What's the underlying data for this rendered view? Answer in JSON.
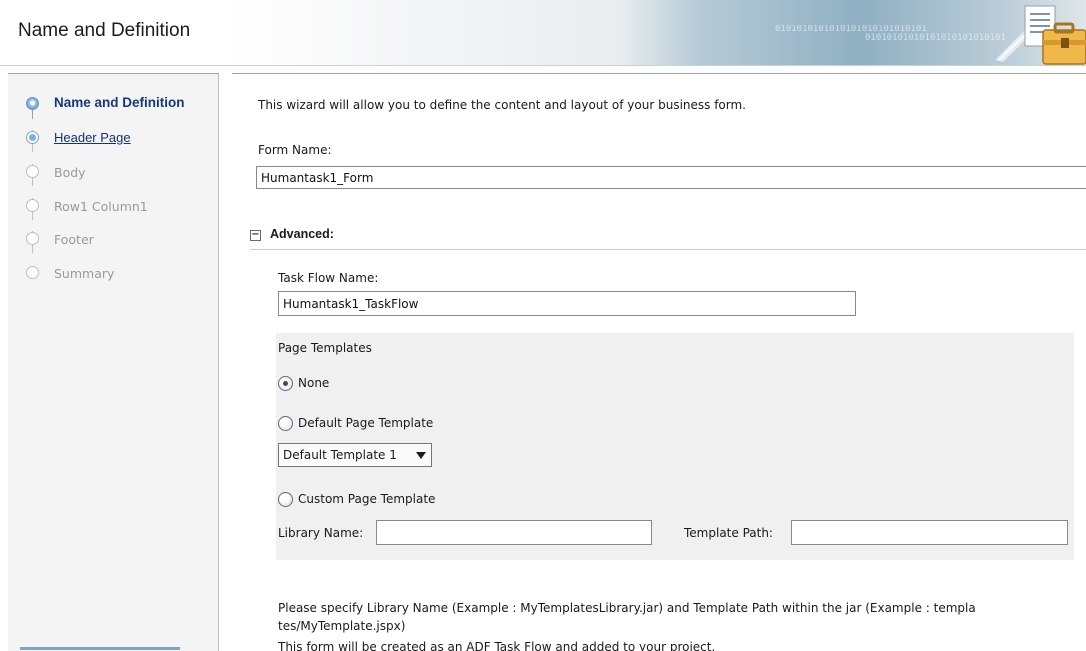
{
  "header": {
    "title": "Name and Definition",
    "binary_text": "0101010101010101010101010101",
    "banner_icon": "briefcase-document-icon"
  },
  "train": {
    "steps": [
      {
        "label": "Name and Definition",
        "state": "current"
      },
      {
        "label": "Header Page",
        "state": "link"
      },
      {
        "label": "Body",
        "state": "disabled"
      },
      {
        "label": "Row1 Column1",
        "state": "disabled"
      },
      {
        "label": "Footer",
        "state": "disabled"
      },
      {
        "label": "Summary",
        "state": "disabled"
      }
    ]
  },
  "main": {
    "intro": "This wizard will allow you to define the content and layout of your business form.",
    "form_name_label": "Form Name:",
    "form_name_value": "Humantask1_Form",
    "advanced": {
      "title": "Advanced:",
      "collapse_symbol": "−",
      "task_flow_label": "Task Flow Name:",
      "task_flow_value": "Humantask1_TaskFlow",
      "page_templates_title": "Page Templates",
      "options": [
        {
          "label": "None",
          "checked": true
        },
        {
          "label": "Default Page Template",
          "checked": false
        },
        {
          "label": "Custom Page Template",
          "checked": false
        }
      ],
      "template_select_value": "Default Template 1",
      "library_name_label": "Library Name:",
      "library_name_value": "",
      "template_path_label": "Template Path:",
      "template_path_value": "",
      "help_text": "Please specify Library Name (Example : MyTemplatesLibrary.jar) and Template Path within the jar (Example : templa tes/MyTemplate.jspx)"
    },
    "footer_note": "This form will be created as an ADF Task Flow and added to your project."
  },
  "colors": {
    "current_step": "#16387a",
    "disabled_step": "#9a9a9a",
    "panel_bg": "#f0f0f0",
    "sidebar_bg": "#f4f4f4"
  }
}
